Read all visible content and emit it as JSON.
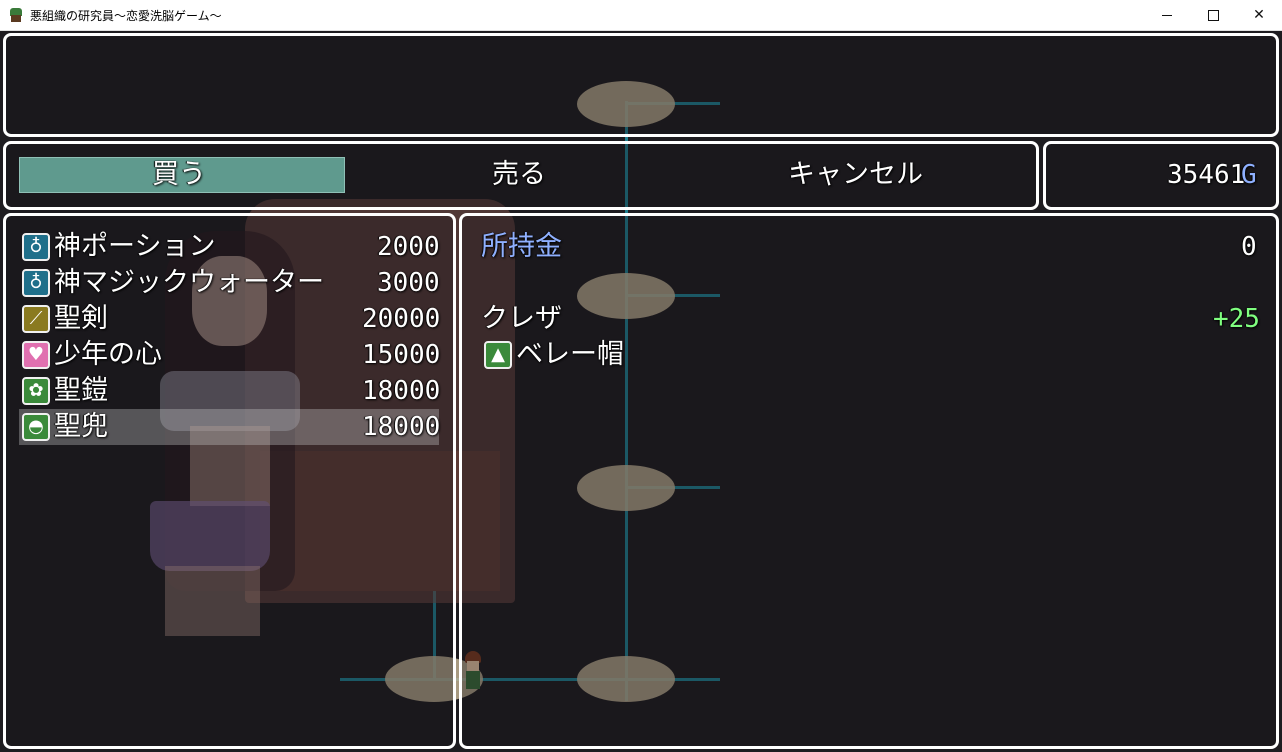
{
  "window": {
    "title": "悪組織の研究員～恋愛洗脳ゲーム～",
    "minimize_icon": "minimize-icon",
    "maximize_icon": "maximize-icon",
    "close_icon": "close-icon"
  },
  "commands": {
    "buy": "買う",
    "sell": "売る",
    "cancel": "キャンセル",
    "selected": "buy"
  },
  "gold": {
    "amount": "35461",
    "unit": "G"
  },
  "shop_items": [
    {
      "icon": "potion-icon",
      "name": "神ポーション",
      "price": "2000"
    },
    {
      "icon": "potion-icon",
      "name": "神マジックウォーター",
      "price": "3000"
    },
    {
      "icon": "sword-icon",
      "name": "聖剣",
      "price": "20000"
    },
    {
      "icon": "heart-icon",
      "name": "少年の心",
      "price": "15000"
    },
    {
      "icon": "armor-icon",
      "name": "聖鎧",
      "price": "18000"
    },
    {
      "icon": "helmet-icon",
      "name": "聖兜",
      "price": "18000"
    }
  ],
  "selected_item_index": 5,
  "status": {
    "possession_label": "所持金",
    "possession_value": "0",
    "actor_name": "クレザ",
    "param_change": "+25",
    "equipped_icon": "hat-icon",
    "equipped_item": "ベレー帽"
  },
  "colors": {
    "system_blue": "#8fb0ff",
    "power_up_green": "#80ff80",
    "command_highlight": "#5f9a8e"
  }
}
